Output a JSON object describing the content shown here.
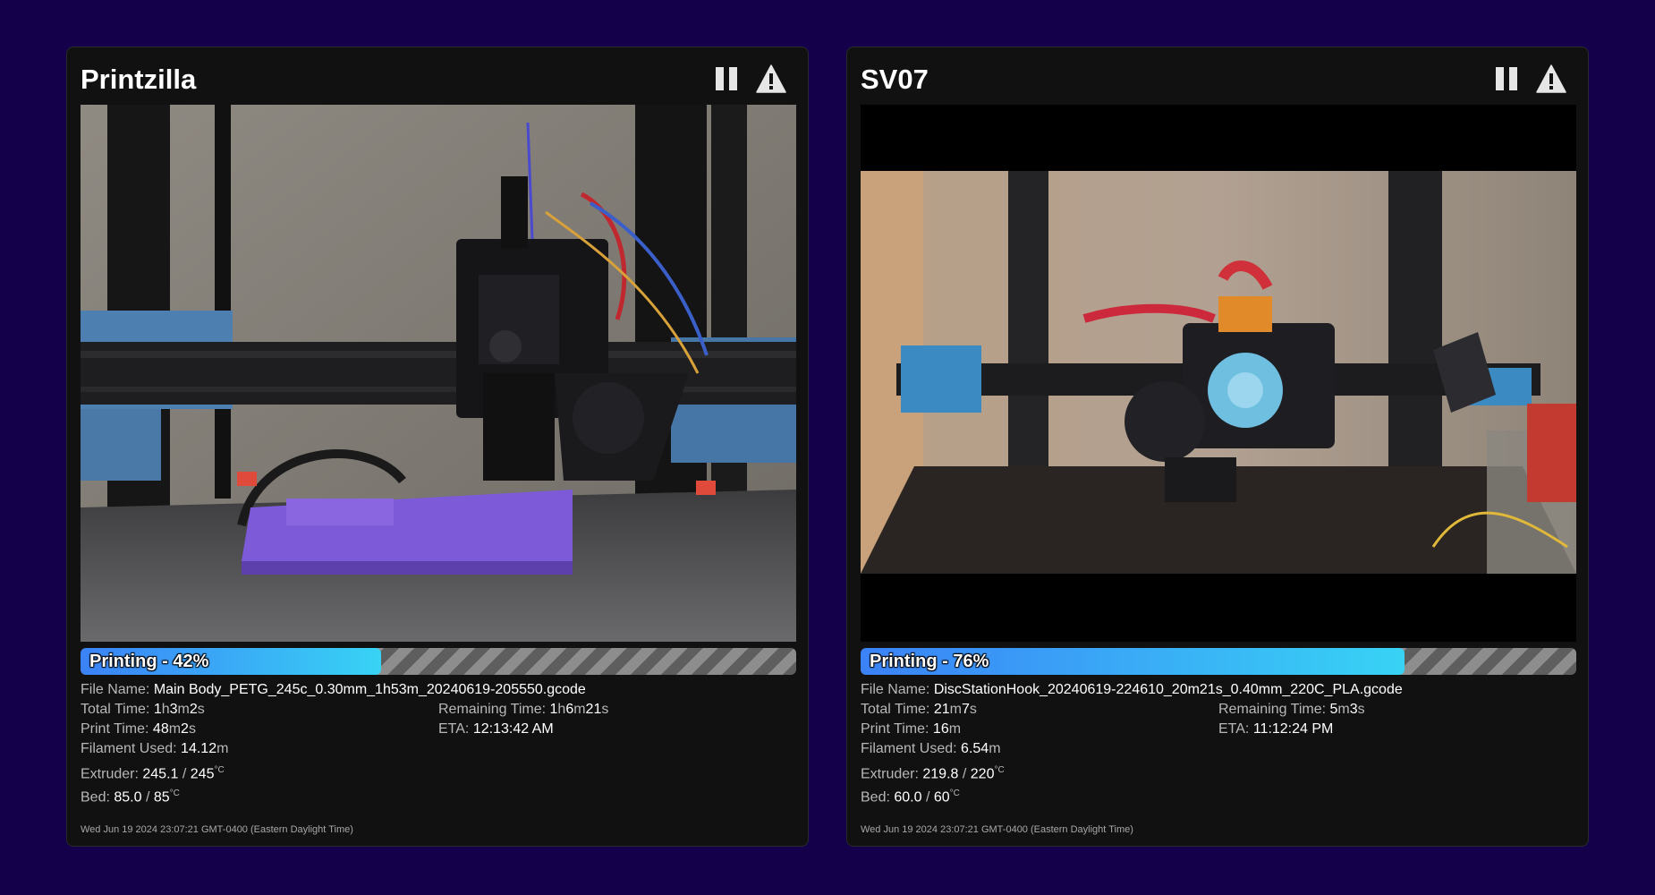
{
  "printers": [
    {
      "name": "Printzilla",
      "status": "Printing - 42%",
      "progress_percent": 42,
      "labels": {
        "file": "File Name:",
        "total": "Total Time:",
        "remaining": "Remaining Time:",
        "print": "Print Time:",
        "eta": "ETA:",
        "filament": "Filament Used:",
        "extruder": "Extruder:",
        "bed": "Bed:"
      },
      "file_name": "Main Body_PETG_245c_0.30mm_1h53m_20240619-205550.gcode",
      "total_time": {
        "h": "1",
        "m": "3",
        "s": "2"
      },
      "remaining_time": {
        "h": "1",
        "m": "6",
        "s": "21"
      },
      "print_time": {
        "m": "48",
        "s": "2"
      },
      "eta": "12:13:42 AM",
      "filament_used": "14.12",
      "filament_unit": "m",
      "extruder": {
        "current": "245.1",
        "target": "245"
      },
      "bed": {
        "current": "85.0",
        "target": "85"
      },
      "temp_unit": "°C",
      "timestamp": "Wed Jun 19 2024 23:07:21 GMT-0400 (Eastern Daylight Time)",
      "actions": {
        "pause_icon": "pause-icon",
        "alert_icon": "warning-icon"
      }
    },
    {
      "name": "SV07",
      "status": "Printing - 76%",
      "progress_percent": 76,
      "labels": {
        "file": "File Name:",
        "total": "Total Time:",
        "remaining": "Remaining Time:",
        "print": "Print Time:",
        "eta": "ETA:",
        "filament": "Filament Used:",
        "extruder": "Extruder:",
        "bed": "Bed:"
      },
      "file_name": "DiscStationHook_20240619-224610_20m21s_0.40mm_220C_PLA.gcode",
      "total_time": {
        "m": "21",
        "s": "7"
      },
      "remaining_time": {
        "m": "5",
        "s": "3"
      },
      "print_time": {
        "m": "16"
      },
      "eta": "11:12:24 PM",
      "filament_used": "6.54",
      "filament_unit": "m",
      "extruder": {
        "current": "219.8",
        "target": "220"
      },
      "bed": {
        "current": "60.0",
        "target": "60"
      },
      "temp_unit": "°C",
      "timestamp": "Wed Jun 19 2024 23:07:21 GMT-0400 (Eastern Daylight Time)",
      "actions": {
        "pause_icon": "pause-icon",
        "alert_icon": "warning-icon"
      }
    }
  ],
  "units": {
    "h": "h",
    "m": "m",
    "s": "s"
  },
  "colors": {
    "background": "#14004a",
    "card": "#111111",
    "progress_start": "#3b82f6",
    "progress_end": "#38d3f5"
  }
}
